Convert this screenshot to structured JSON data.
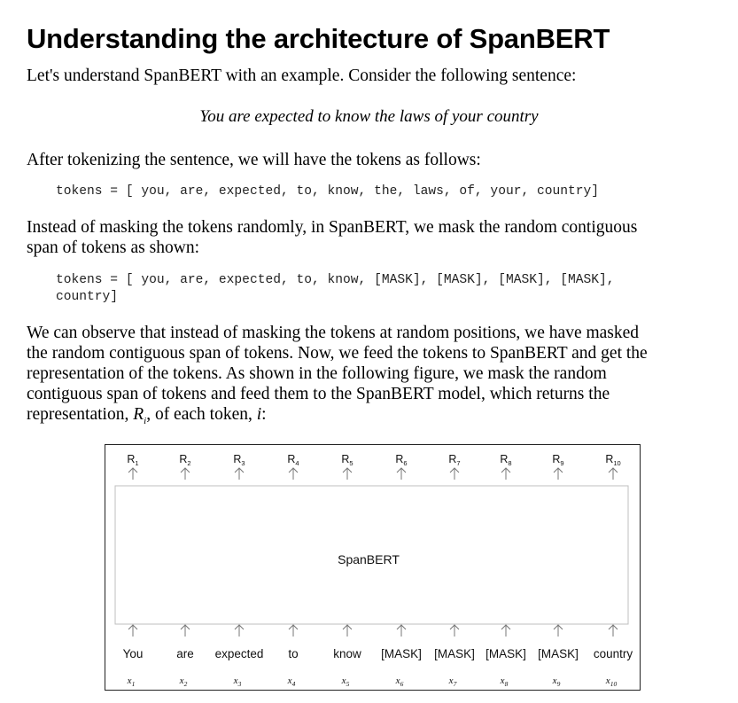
{
  "heading": "Understanding the architecture of SpanBERT",
  "intro": "Let's understand SpanBERT with an example. Consider the following sentence:",
  "example_sentence": "You are expected to know the laws of your country",
  "after_tokenizing": "After tokenizing the sentence, we will have the tokens as follows:",
  "tokens_code": "tokens = [ you, are, expected, to, know, the, laws, of, your, country]",
  "span_mask_text_line1": "Instead of masking the tokens randomly, in SpanBERT, we mask the random contiguous",
  "span_mask_text_line2": "span of tokens as shown:",
  "masked_code_line1": "tokens = [ you, are, expected, to, know, [MASK], [MASK], [MASK], [MASK],",
  "masked_code_line2": "country]",
  "observe_lines": [
    "We can observe that instead of masking the tokens at random positions, we have masked",
    "the random contiguous span of tokens. Now, we feed the tokens to SpanBERT and get the",
    "representation of the tokens. As shown in the following figure, we mask the random",
    "contiguous span of tokens and feed them to the SpanBERT model, which returns the"
  ],
  "observe_last": {
    "prefix": "representation, ",
    "rep_symbol": "R",
    "rep_sub": "i",
    "middle": ", of each token, ",
    "token_symbol": "i",
    "suffix": ":"
  },
  "figure": {
    "model_label": "SpanBERT",
    "outputs": [
      "R1",
      "R2",
      "R3",
      "R4",
      "R5",
      "R6",
      "R7",
      "R8",
      "R9",
      "R10"
    ],
    "output_symbol": "R",
    "input_words": [
      "You",
      "are",
      "expected",
      "to",
      "know",
      "[MASK]",
      "[MASK]",
      "[MASK]",
      "[MASK]",
      "country"
    ],
    "input_symbol": "x",
    "indices": [
      "1",
      "2",
      "3",
      "4",
      "5",
      "6",
      "7",
      "8",
      "9",
      "10"
    ]
  }
}
